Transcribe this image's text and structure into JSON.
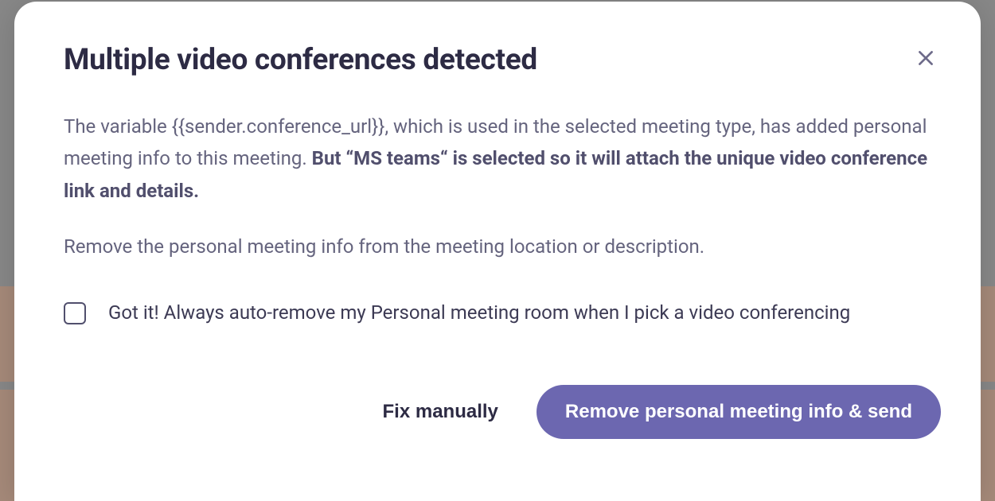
{
  "modal": {
    "title": "Multiple video conferences detected",
    "para1_pre": "The variable {{sender.conference_url}}, which is used in the selected meeting type, has added personal meeting info to this meeting. ",
    "para1_bold": "But “MS teams“ is selected so it will attach the unique video conference link and details.",
    "para2": "Remove the personal meeting info from the meeting location or description.",
    "checkbox_label": "Got it! Always auto-remove my Personal meeting room when I pick a video conferencing",
    "buttons": {
      "secondary": "Fix manually",
      "primary": "Remove personal meeting info & send"
    }
  }
}
